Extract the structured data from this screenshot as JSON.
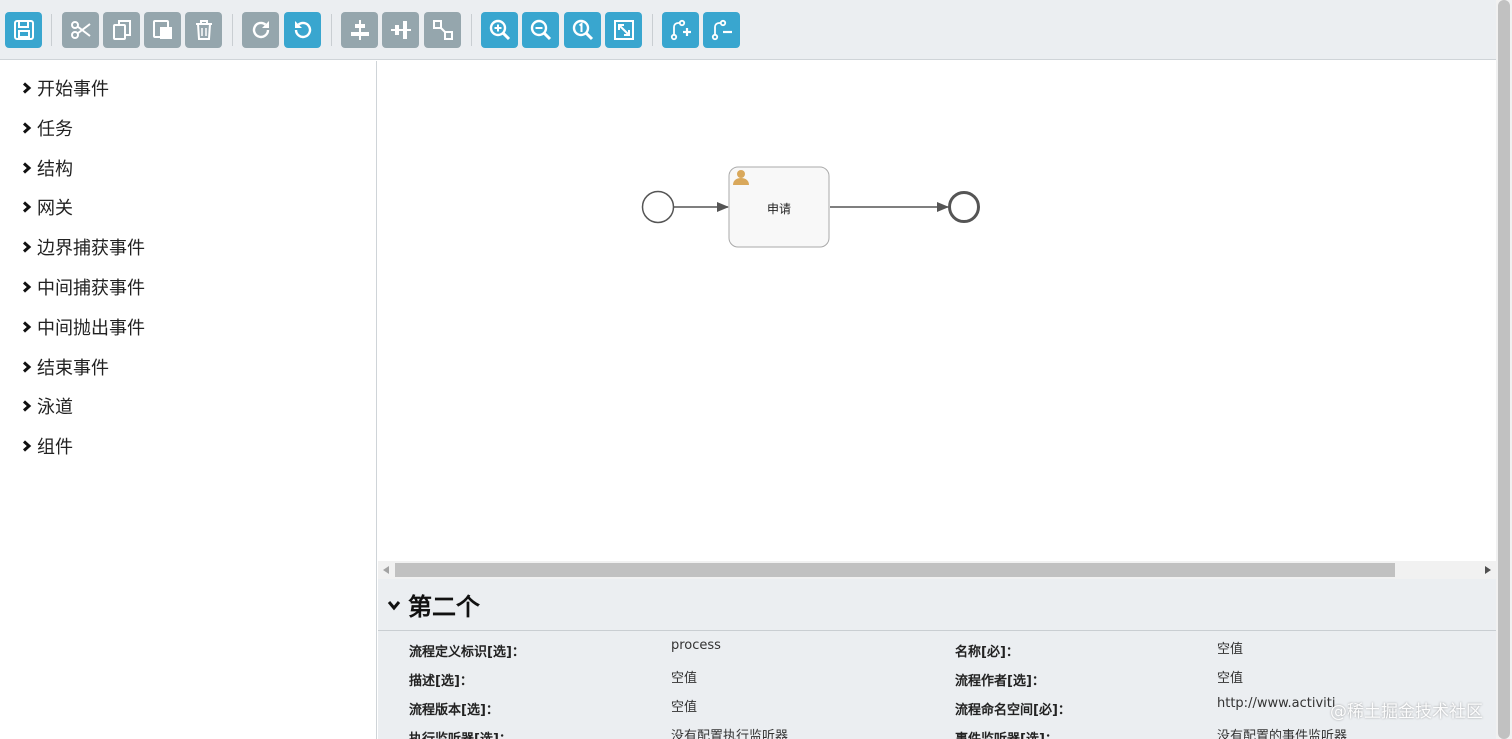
{
  "toolbar": {
    "buttons": [
      {
        "name": "save",
        "tooltip": "save"
      },
      {
        "name": "cut"
      },
      {
        "name": "copy"
      },
      {
        "name": "paste"
      },
      {
        "name": "delete"
      },
      {
        "name": "redo"
      },
      {
        "name": "undo"
      },
      {
        "name": "align-horizontal"
      },
      {
        "name": "align-vertical"
      },
      {
        "name": "same-size"
      },
      {
        "name": "zoom-in"
      },
      {
        "name": "zoom-out"
      },
      {
        "name": "zoom-actual"
      },
      {
        "name": "zoom-fit"
      },
      {
        "name": "add-bendpoint"
      },
      {
        "name": "remove-bendpoint"
      }
    ],
    "colors": {
      "blue": "#39a6cf",
      "gray": "#95a6ad"
    }
  },
  "palette": {
    "items": [
      "开始事件",
      "任务",
      "结构",
      "网关",
      "边界捕获事件",
      "中间捕获事件",
      "中间抛出事件",
      "结束事件",
      "泳道",
      "组件"
    ]
  },
  "diagram": {
    "task_label": "申请",
    "elements": [
      "start-event",
      "user-task",
      "end-event"
    ]
  },
  "properties": {
    "title": "第二个",
    "rows": [
      {
        "label": "流程定义标识[选]：",
        "value": "process",
        "label2": "名称[必]：",
        "value2": "空值"
      },
      {
        "label": "描述[选]：",
        "value": "空值",
        "label2": "流程作者[选]：",
        "value2": "空值"
      },
      {
        "label": "流程版本[选]：",
        "value": "空值",
        "label2": "流程命名空间[必]：",
        "value2": "http://www.activiti"
      },
      {
        "label": "执行监听器[选]：",
        "value": "没有配置执行监听器",
        "label2": "事件监听器[选]：",
        "value2": "没有配置的事件监听器"
      }
    ]
  },
  "watermark": "@稀土掘金技术社区"
}
